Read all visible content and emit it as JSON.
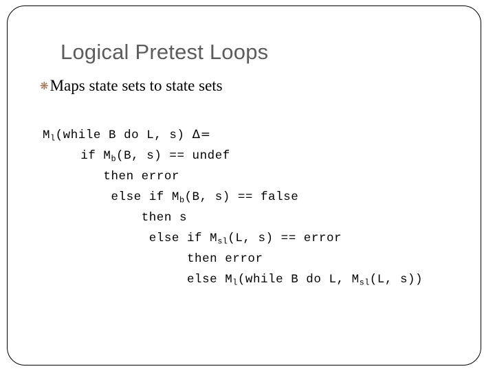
{
  "slide": {
    "title": "Logical Pretest Loops",
    "frame_color": "#000000",
    "background_color": "#ffffff",
    "title_color": "#5c5c5c"
  },
  "bullet": {
    "marker_glyph": "❋",
    "marker_color": "#9e6b4a",
    "text": "Maps state sets to state sets"
  },
  "code": {
    "lines": [
      {
        "indent": 0,
        "segments": [
          {
            "text": "M",
            "sub": false
          },
          {
            "text": "l",
            "sub": true
          },
          {
            "text": "(while B do L, s) ",
            "sub": false
          },
          {
            "text": "Δ=",
            "sub": false,
            "delta": true
          }
        ]
      },
      {
        "indent": 5,
        "segments": [
          {
            "text": "if M",
            "sub": false
          },
          {
            "text": "b",
            "sub": true
          },
          {
            "text": "(B, s) == undef",
            "sub": false
          }
        ]
      },
      {
        "indent": 8,
        "segments": [
          {
            "text": "then error",
            "sub": false
          }
        ]
      },
      {
        "indent": 9,
        "segments": [
          {
            "text": "else if M",
            "sub": false
          },
          {
            "text": "b",
            "sub": true
          },
          {
            "text": "(B, s) == false",
            "sub": false
          }
        ]
      },
      {
        "indent": 13,
        "segments": [
          {
            "text": "then s",
            "sub": false
          }
        ]
      },
      {
        "indent": 14,
        "segments": [
          {
            "text": "else if M",
            "sub": false
          },
          {
            "text": "sl",
            "sub": true
          },
          {
            "text": "(L, s) == error",
            "sub": false
          }
        ]
      },
      {
        "indent": 19,
        "segments": [
          {
            "text": "then error",
            "sub": false
          }
        ]
      },
      {
        "indent": 19,
        "segments": [
          {
            "text": "else M",
            "sub": false
          },
          {
            "text": "l",
            "sub": true
          },
          {
            "text": "(while B do L, M",
            "sub": false
          },
          {
            "text": "sl",
            "sub": true
          },
          {
            "text": "(L, s))",
            "sub": false
          }
        ]
      }
    ]
  }
}
